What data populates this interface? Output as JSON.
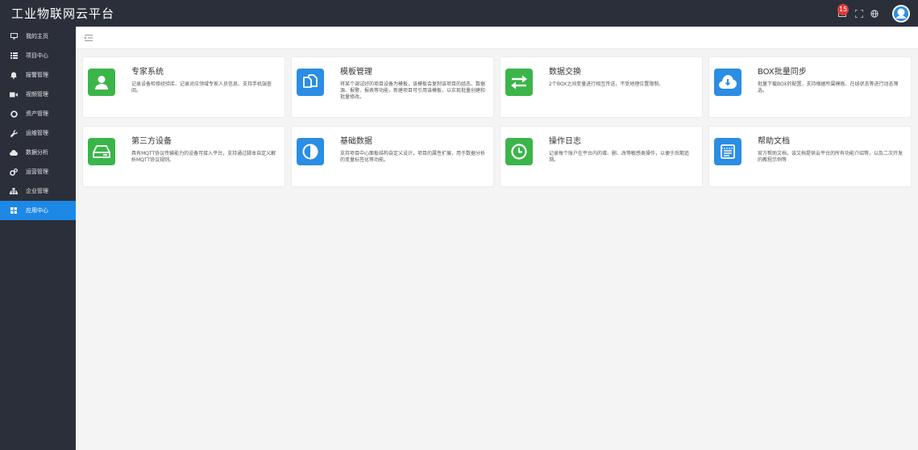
{
  "app": {
    "title": "工业物联网云平台"
  },
  "header": {
    "notification_count": "15"
  },
  "colors": {
    "green": "#3bb54a",
    "blue": "#2b8de3",
    "sidebar": "#2b2f3a",
    "active": "#1e88e5"
  },
  "sidebar": {
    "items": [
      {
        "label": "我的主页",
        "icon": "monitor-icon"
      },
      {
        "label": "项目中心",
        "icon": "list-icon"
      },
      {
        "label": "报警管理",
        "icon": "bell-icon"
      },
      {
        "label": "视频管理",
        "icon": "video-icon"
      },
      {
        "label": "资产管理",
        "icon": "circle-icon"
      },
      {
        "label": "运维管理",
        "icon": "wrench-icon"
      },
      {
        "label": "数据分析",
        "icon": "cloud-icon"
      },
      {
        "label": "运营管理",
        "icon": "gears-icon"
      },
      {
        "label": "企业管理",
        "icon": "org-icon"
      },
      {
        "label": "应用中心",
        "icon": "grid-icon",
        "active": true
      }
    ]
  },
  "cards": [
    {
      "title": "专家系统",
      "desc": "记录设备检修经验库、记录对应领域专家人员信息、支持手机端查阅。",
      "icon": "user-icon",
      "color": "#3bb54a"
    },
    {
      "title": "模板管理",
      "desc": "将某个调试好的项目设备为模板，该模板会复制该项目的组态、数据源、报警、报表等功能，新建项目可引用该模板，以实现批量创建和批量修改。",
      "icon": "copy-icon",
      "color": "#2b8de3"
    },
    {
      "title": "数据交换",
      "desc": "2个BOX之间变量进行相互传送，不受地理位置限制。",
      "icon": "exchange-icon",
      "color": "#3bb54a"
    },
    {
      "title": "BOX批量同步",
      "desc": "批量下载BOX的配置，支持根据所属模板、在线状态等进行动态筛选。",
      "icon": "cloud-download-icon",
      "color": "#2b8de3"
    },
    {
      "title": "第三方设备",
      "desc": "具有MQTT协议传输能力的设备可接入平台，支持通过脚本自定义解析MQTT协议规则。",
      "icon": "hdd-icon",
      "color": "#3bb54a"
    },
    {
      "title": "基础数据",
      "desc": "支持项目中心面板结构自定义设计，项目的属性扩展，用于数据分析的变量标签化等功能。",
      "icon": "contrast-icon",
      "color": "#2b8de3"
    },
    {
      "title": "操作日志",
      "desc": "记录每个账户在平台内的增、删、改等敏感类操作，以便于后期追溯。",
      "icon": "clock-icon",
      "color": "#3bb54a"
    },
    {
      "title": "帮助文档",
      "desc": "官方帮助文档，该文档提供云平台的所有功能介绍等，以及二次开发的教程示例等",
      "icon": "document-icon",
      "color": "#2b8de3"
    }
  ]
}
